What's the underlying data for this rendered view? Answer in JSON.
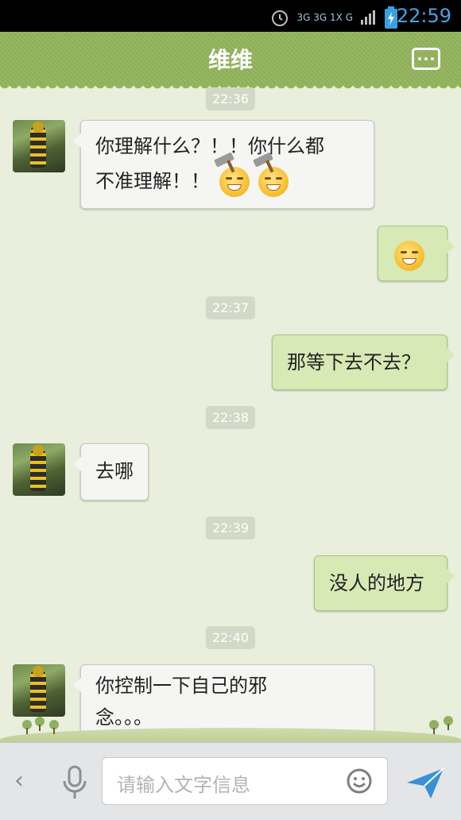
{
  "status_bar": {
    "network_label": "3G 3G 1X G",
    "time": "22:59"
  },
  "header": {
    "title": "维维"
  },
  "messages": [
    {
      "type": "timestamp",
      "text": "22:36"
    },
    {
      "type": "incoming",
      "text_line1": "你理解什么？！！你什么都",
      "text_line2": "不准理解！！",
      "emoji_after": [
        "hammer-angry-emoji",
        "hammer-angry-emoji"
      ]
    },
    {
      "type": "outgoing",
      "emoji": "grinning-emoji"
    },
    {
      "type": "timestamp",
      "text": "22:37"
    },
    {
      "type": "outgoing",
      "text": "那等下去不去？"
    },
    {
      "type": "timestamp",
      "text": "22:38"
    },
    {
      "type": "incoming",
      "text": "去哪"
    },
    {
      "type": "timestamp",
      "text": "22:39"
    },
    {
      "type": "outgoing",
      "text": "没人的地方"
    },
    {
      "type": "timestamp",
      "text": "22:40"
    },
    {
      "type": "incoming",
      "text_line1": "你控制一下自己的邪",
      "text_line2": "念。。。"
    }
  ],
  "input_bar": {
    "placeholder": "请输入文字信息"
  },
  "colors": {
    "header_green": "#94b45c",
    "chat_bg": "#e9efdc",
    "outgoing_bubble": "#d7e9b5",
    "incoming_bubble": "#f5f5f3",
    "send_blue": "#3a8fd6"
  }
}
